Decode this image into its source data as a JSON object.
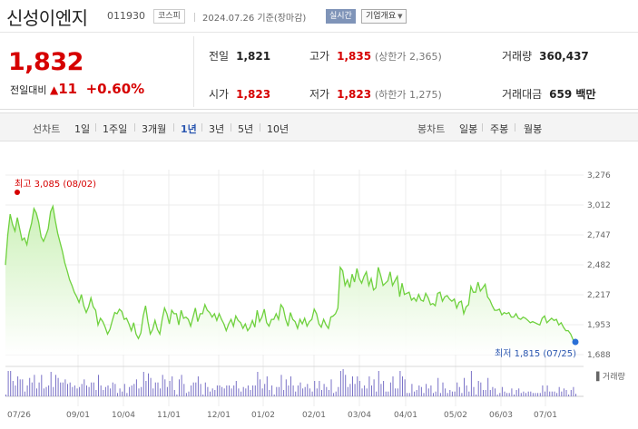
{
  "header": {
    "stock_name": "신성이엔지",
    "stock_code": "011930",
    "market": "코스피",
    "date_text": "2024.07.26 기준(장마감)",
    "realtime_label": "실시간",
    "company_button": "기업개요"
  },
  "price": {
    "current": "1,832",
    "change_label": "전일대비",
    "change_value": "11",
    "change_pct": "+0.60%",
    "prev_close_label": "전일",
    "prev_close": "1,821",
    "high_label": "고가",
    "high": "1,835",
    "upper_limit": "(상한가 2,365)",
    "volume_label": "거래량",
    "volume": "360,437",
    "open_label": "시가",
    "open": "1,823",
    "low_label": "저가",
    "low": "1,823",
    "lower_limit": "(하한가 1,275)",
    "amount_label": "거래대금",
    "amount": "659 백만"
  },
  "periods": {
    "line_label": "선차트",
    "items": [
      "1일",
      "1주일",
      "3개월",
      "1년",
      "3년",
      "5년",
      "10년"
    ],
    "active": "1년",
    "candle_label": "봉차트",
    "candle_items": [
      "일봉",
      "주봉",
      "월봉"
    ]
  },
  "chart_data": {
    "type": "area",
    "y_ticks": [
      "3,276",
      "3,012",
      "2,747",
      "2,482",
      "2,217",
      "1,953",
      "1,688"
    ],
    "ylim": [
      1688,
      3276
    ],
    "x_ticks": [
      "07/26",
      "09/01",
      "10/04",
      "11/01",
      "12/01",
      "01/02",
      "02/01",
      "03/04",
      "04/01",
      "05/02",
      "06/03",
      "07/01"
    ],
    "max_label": "최고 3,085 (08/02)",
    "min_label": "최저 1,815 (07/25)",
    "volume_label": "거래량",
    "values": [
      2480,
      2750,
      2930,
      2840,
      2780,
      2900,
      2800,
      2700,
      2720,
      2660,
      2770,
      2850,
      2980,
      2940,
      2860,
      2730,
      2690,
      2740,
      2800,
      2950,
      3000,
      2870,
      2760,
      2680,
      2600,
      2500,
      2430,
      2350,
      2300,
      2240,
      2200,
      2150,
      2220,
      2120,
      2060,
      2110,
      2190,
      2110,
      2080,
      1950,
      2010,
      1980,
      1930,
      1870,
      1910,
      1990,
      2060,
      2050,
      2090,
      2070,
      2000,
      2010,
      1960,
      1900,
      1970,
      1870,
      1830,
      1880,
      2030,
      2120,
      1980,
      1870,
      1910,
      1990,
      1910,
      1870,
      2000,
      2100,
      2050,
      1960,
      2080,
      2050,
      2050,
      1950,
      2080,
      2010,
      2020,
      2000,
      1940,
      2020,
      2100,
      1980,
      2050,
      2050,
      2130,
      2080,
      2060,
      2020,
      2050,
      1990,
      2050,
      2000,
      1960,
      1900,
      1960,
      2000,
      1940,
      2030,
      1990,
      1970,
      1920,
      1960,
      1900,
      1930,
      1990,
      1930,
      2080,
      1980,
      2020,
      2090,
      1970,
      1940,
      2000,
      2000,
      2050,
      2000,
      2130,
      2100,
      2000,
      1940,
      2060,
      2000,
      1980,
      1920,
      2000,
      1960,
      2010,
      1940,
      1980,
      2000,
      2090,
      2050,
      1960,
      1930,
      2000,
      1950,
      1920,
      2020,
      2030,
      2050,
      2100,
      2460,
      2430,
      2300,
      2350,
      2280,
      2400,
      2330,
      2450,
      2360,
      2320,
      2380,
      2420,
      2300,
      2360,
      2260,
      2280,
      2460,
      2390,
      2300,
      2320,
      2340,
      2420,
      2300,
      2340,
      2380,
      2200,
      2320,
      2220,
      2230,
      2240,
      2170,
      2190,
      2160,
      2220,
      2170,
      2160,
      2230,
      2190,
      2130,
      2140,
      2120,
      2230,
      2240,
      2160,
      2200,
      2210,
      2180,
      2160,
      2180,
      2100,
      2150,
      2160,
      2050,
      2110,
      2130,
      2290,
      2240,
      2240,
      2330,
      2250,
      2280,
      2310,
      2200,
      2170,
      2120,
      2080,
      2080,
      2090,
      2040,
      2060,
      2050,
      2060,
      2020,
      2020,
      2050,
      2010,
      2000,
      2020,
      2010,
      1990,
      1970,
      1980,
      1970,
      1960,
      1950,
      2010,
      2030,
      1970,
      1990,
      2010,
      1990,
      2000,
      1950,
      1970,
      1930,
      1900,
      1900,
      1870,
      1820,
      1815
    ]
  }
}
